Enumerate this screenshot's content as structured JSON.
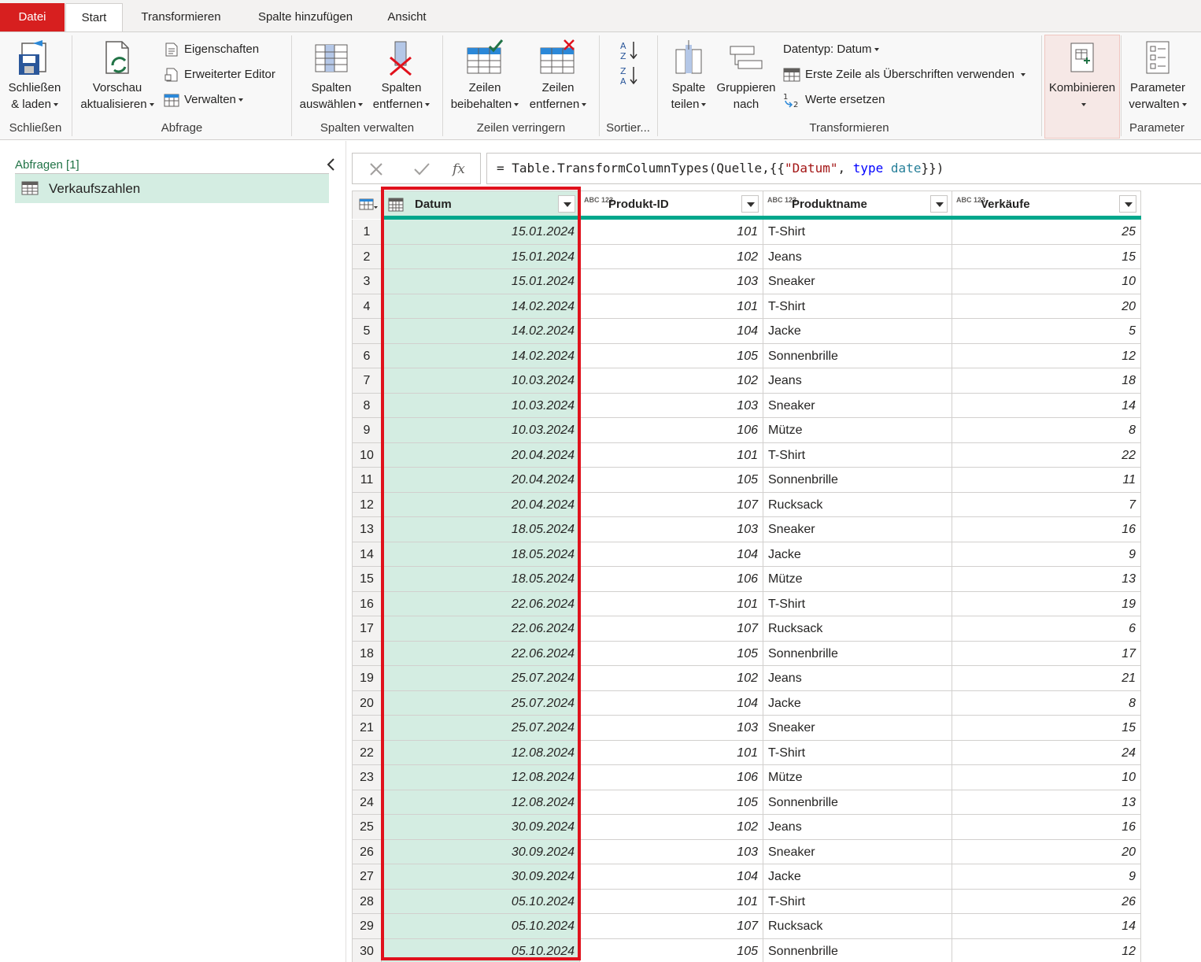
{
  "tabs": [
    {
      "label": "Datei"
    },
    {
      "label": "Start"
    },
    {
      "label": "Transformieren"
    },
    {
      "label": "Spalte hinzufügen"
    },
    {
      "label": "Ansicht"
    }
  ],
  "ribbon": {
    "schliessen": {
      "line1": "Schließen",
      "line2": "& laden",
      "group": "Schließen"
    },
    "abfrage": {
      "vorschau_line1": "Vorschau",
      "vorschau_line2": "aktualisieren",
      "eigenschaften": "Eigenschaften",
      "erweiterter_editor": "Erweiterter Editor",
      "verwalten": "Verwalten",
      "group": "Abfrage"
    },
    "spalten_verwalten": {
      "auswaehlen_line1": "Spalten",
      "auswaehlen_line2": "auswählen",
      "entfernen_line1": "Spalten",
      "entfernen_line2": "entfernen",
      "group": "Spalten verwalten"
    },
    "zeilen_verringern": {
      "beibehalten_line1": "Zeilen",
      "beibehalten_line2": "beibehalten",
      "entfernen_line1": "Zeilen",
      "entfernen_line2": "entfernen",
      "group": "Zeilen verringern"
    },
    "sortieren": {
      "group": "Sortier..."
    },
    "transformieren": {
      "spalte_teilen_line1": "Spalte",
      "spalte_teilen_line2": "teilen",
      "gruppieren_line1": "Gruppieren",
      "gruppieren_line2": "nach",
      "datentyp": "Datentyp: Datum",
      "erste_zeile": "Erste Zeile als Überschriften verwenden",
      "werte_ersetzen": "Werte ersetzen",
      "group": "Transformieren"
    },
    "kombinieren": {
      "label": "Kombinieren"
    },
    "parameter": {
      "verwalten_line1": "Parameter",
      "verwalten_line2": "verwalten",
      "group": "Parameter"
    }
  },
  "queries_pane": {
    "header": "Abfragen [1]",
    "items": [
      {
        "label": "Verkaufszahlen"
      }
    ]
  },
  "formula_bar": {
    "prefix": "= Table.TransformColumnTypes(Quelle,{{",
    "string": "\"Datum\"",
    "sep": ", ",
    "kw": "type",
    "space": " ",
    "ty": "date",
    "suffix": "}})"
  },
  "table": {
    "columns": [
      {
        "name": "Datum",
        "type_icon": "calendar-icon"
      },
      {
        "name": "Produkt-ID",
        "type_icon": "ABC 123"
      },
      {
        "name": "Produktname",
        "type_icon": "ABC 123"
      },
      {
        "name": "Verkäufe",
        "type_icon": "ABC 123"
      }
    ],
    "rows": [
      [
        "1",
        "15.01.2024",
        "101",
        "T-Shirt",
        "25"
      ],
      [
        "2",
        "15.01.2024",
        "102",
        "Jeans",
        "15"
      ],
      [
        "3",
        "15.01.2024",
        "103",
        "Sneaker",
        "10"
      ],
      [
        "4",
        "14.02.2024",
        "101",
        "T-Shirt",
        "20"
      ],
      [
        "5",
        "14.02.2024",
        "104",
        "Jacke",
        "5"
      ],
      [
        "6",
        "14.02.2024",
        "105",
        "Sonnenbrille",
        "12"
      ],
      [
        "7",
        "10.03.2024",
        "102",
        "Jeans",
        "18"
      ],
      [
        "8",
        "10.03.2024",
        "103",
        "Sneaker",
        "14"
      ],
      [
        "9",
        "10.03.2024",
        "106",
        "Mütze",
        "8"
      ],
      [
        "10",
        "20.04.2024",
        "101",
        "T-Shirt",
        "22"
      ],
      [
        "11",
        "20.04.2024",
        "105",
        "Sonnenbrille",
        "11"
      ],
      [
        "12",
        "20.04.2024",
        "107",
        "Rucksack",
        "7"
      ],
      [
        "13",
        "18.05.2024",
        "103",
        "Sneaker",
        "16"
      ],
      [
        "14",
        "18.05.2024",
        "104",
        "Jacke",
        "9"
      ],
      [
        "15",
        "18.05.2024",
        "106",
        "Mütze",
        "13"
      ],
      [
        "16",
        "22.06.2024",
        "101",
        "T-Shirt",
        "19"
      ],
      [
        "17",
        "22.06.2024",
        "107",
        "Rucksack",
        "6"
      ],
      [
        "18",
        "22.06.2024",
        "105",
        "Sonnenbrille",
        "17"
      ],
      [
        "19",
        "25.07.2024",
        "102",
        "Jeans",
        "21"
      ],
      [
        "20",
        "25.07.2024",
        "104",
        "Jacke",
        "8"
      ],
      [
        "21",
        "25.07.2024",
        "103",
        "Sneaker",
        "15"
      ],
      [
        "22",
        "12.08.2024",
        "101",
        "T-Shirt",
        "24"
      ],
      [
        "23",
        "12.08.2024",
        "106",
        "Mütze",
        "10"
      ],
      [
        "24",
        "12.08.2024",
        "105",
        "Sonnenbrille",
        "13"
      ],
      [
        "25",
        "30.09.2024",
        "102",
        "Jeans",
        "16"
      ],
      [
        "26",
        "30.09.2024",
        "103",
        "Sneaker",
        "20"
      ],
      [
        "27",
        "30.09.2024",
        "104",
        "Jacke",
        "9"
      ],
      [
        "28",
        "05.10.2024",
        "101",
        "T-Shirt",
        "26"
      ],
      [
        "29",
        "05.10.2024",
        "107",
        "Rucksack",
        "14"
      ],
      [
        "30",
        "05.10.2024",
        "105",
        "Sonnenbrille",
        "12"
      ]
    ]
  },
  "colors": {
    "file_tab": "#d71f1f",
    "accent_green": "#217346",
    "selection_fill": "#d4ede2",
    "quality_bar": "#00a78c",
    "highlight_box": "#e0111c"
  }
}
